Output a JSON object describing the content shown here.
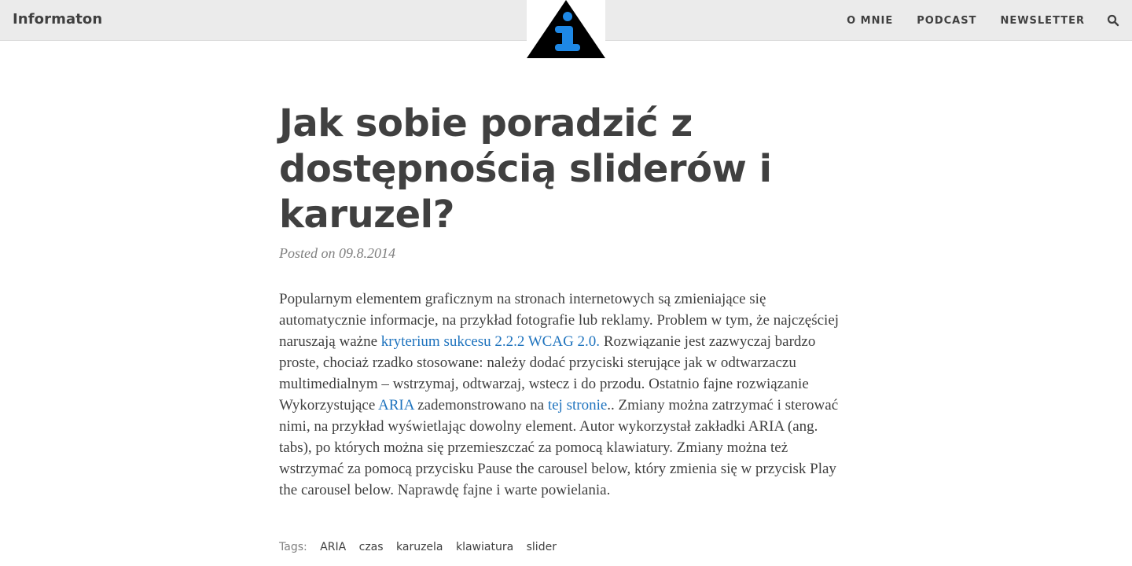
{
  "header": {
    "brand": "Informaton",
    "nav": [
      {
        "label": "O MNIE"
      },
      {
        "label": "PODCAST"
      },
      {
        "label": "NEWSLETTER"
      }
    ],
    "search_icon": "search-icon",
    "logo_icon": "info-triangle-logo"
  },
  "article": {
    "title": "Jak sobie poradzić z dostępnością sliderów i karuzel?",
    "posted": "Posted on 09.8.2014",
    "paragraph": {
      "part1": "Popularnym elementem graficznym na stronach internetowych są zmieniające się automatycznie informacje, na przykład fotografie lub reklamy. Problem w tym, że najczęściej naruszają ważne ",
      "link1": "kryterium sukcesu 2.2.2 WCAG 2.0.",
      "part2": " Rozwiązanie jest zazwyczaj bardzo proste, chociaż rzadko stosowane: należy dodać przyciski sterujące jak w odtwarzaczu multimedialnym – wstrzymaj, odtwarzaj, wstecz i do przodu. Ostatnio fajne rozwiązanie Wykorzystujące ",
      "link2": "ARIA",
      "part3": " zademonstrowano na ",
      "link3": "tej stronie",
      "part4": ".. Zmiany można zatrzymać i sterować nimi, na przykład wyświetlając dowolny element. Autor wykorzystał zakładki ARIA (ang. tabs), po których można się przemieszczać za pomocą klawiatury. Zmiany można też wstrzymać za pomocą przycisku Pause the carousel below, który zmienia się w przycisk Play the carousel below. Naprawdę fajne i warte powielania."
    },
    "tags_label": "Tags:",
    "tags": [
      "ARIA",
      "czas",
      "karuzela",
      "klawiatura",
      "slider"
    ]
  },
  "colors": {
    "topbar_bg": "#ebebeb",
    "text": "#404040",
    "link": "#1e73be",
    "logo_blue": "#1e88e5"
  }
}
